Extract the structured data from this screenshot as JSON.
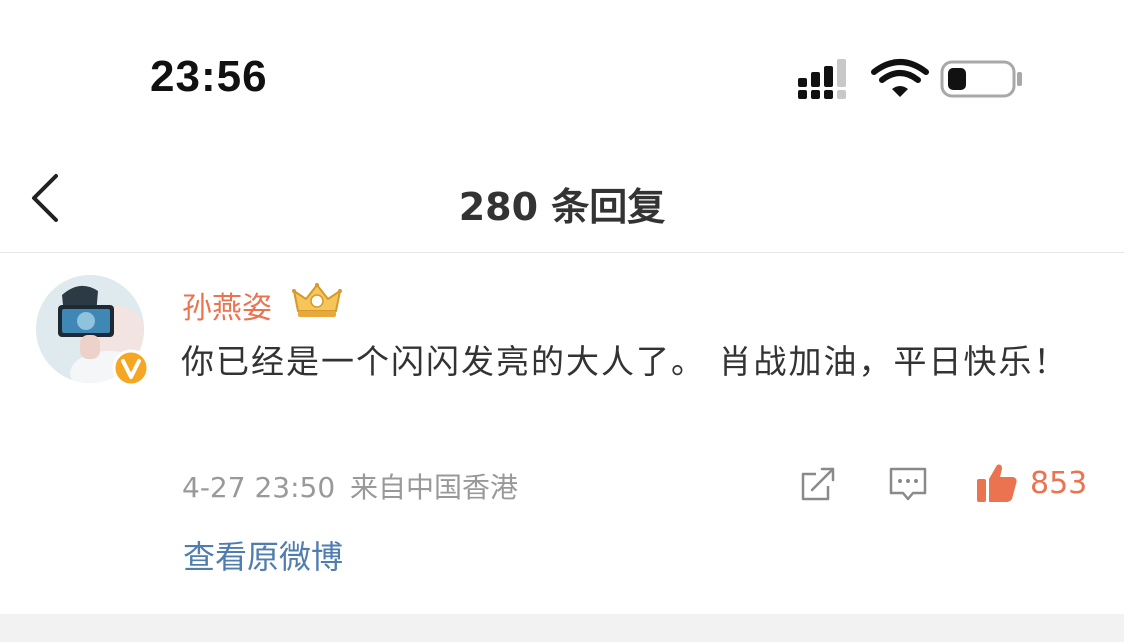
{
  "status_bar": {
    "time": "23:56",
    "icons": [
      "signal-icon",
      "wifi-icon",
      "battery-icon"
    ]
  },
  "header": {
    "back_icon": "chevron-left-icon",
    "title": "280 条回复"
  },
  "comment": {
    "username": "孙燕姿",
    "user_badges": [
      "crown-badge-icon",
      "verified-v-icon"
    ],
    "text": "你已经是一个闪闪发亮的大人了。 肖战加油，平日快乐！",
    "timestamp": "4-27 23:50",
    "source": "来自中国香港",
    "actions": {
      "share_icon": "share-icon",
      "reply_icon": "comment-icon",
      "like_icon": "thumbs-up-icon",
      "like_count": "853"
    },
    "view_original": "查看原微博"
  },
  "colors": {
    "username": "#eb7350",
    "like": "#eb7350",
    "link": "#507daf",
    "meta": "#999999",
    "verified_badge": "#f5a623"
  }
}
